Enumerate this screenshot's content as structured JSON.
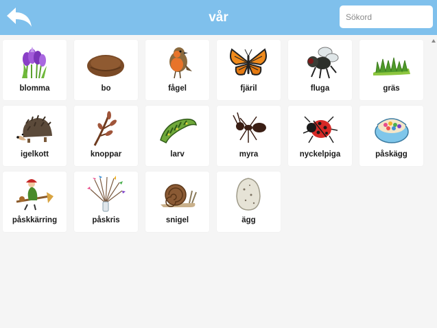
{
  "header": {
    "title": "vår",
    "search_placeholder": "Sökord",
    "search_value": ""
  },
  "colors": {
    "header_bg": "#7fc0ec",
    "page_bg": "#f5f5f5",
    "card_bg": "#ffffff"
  },
  "grid": {
    "items": [
      {
        "label": "blomma",
        "icon": "crocus-flower-icon"
      },
      {
        "label": "bo",
        "icon": "nest-icon"
      },
      {
        "label": "fågel",
        "icon": "robin-bird-icon"
      },
      {
        "label": "fjäril",
        "icon": "butterfly-icon"
      },
      {
        "label": "fluga",
        "icon": "fly-icon"
      },
      {
        "label": "gräs",
        "icon": "grass-icon"
      },
      {
        "label": "igelkott",
        "icon": "hedgehog-icon"
      },
      {
        "label": "knoppar",
        "icon": "willow-buds-icon"
      },
      {
        "label": "larv",
        "icon": "caterpillar-icon"
      },
      {
        "label": "myra",
        "icon": "ant-icon"
      },
      {
        "label": "nyckelpiga",
        "icon": "ladybug-icon"
      },
      {
        "label": "påskägg",
        "icon": "easter-egg-icon"
      },
      {
        "label": "påskkärring",
        "icon": "easter-witch-icon"
      },
      {
        "label": "påskris",
        "icon": "easter-twigs-icon"
      },
      {
        "label": "snigel",
        "icon": "snail-icon"
      },
      {
        "label": "ägg",
        "icon": "egg-icon"
      }
    ]
  }
}
